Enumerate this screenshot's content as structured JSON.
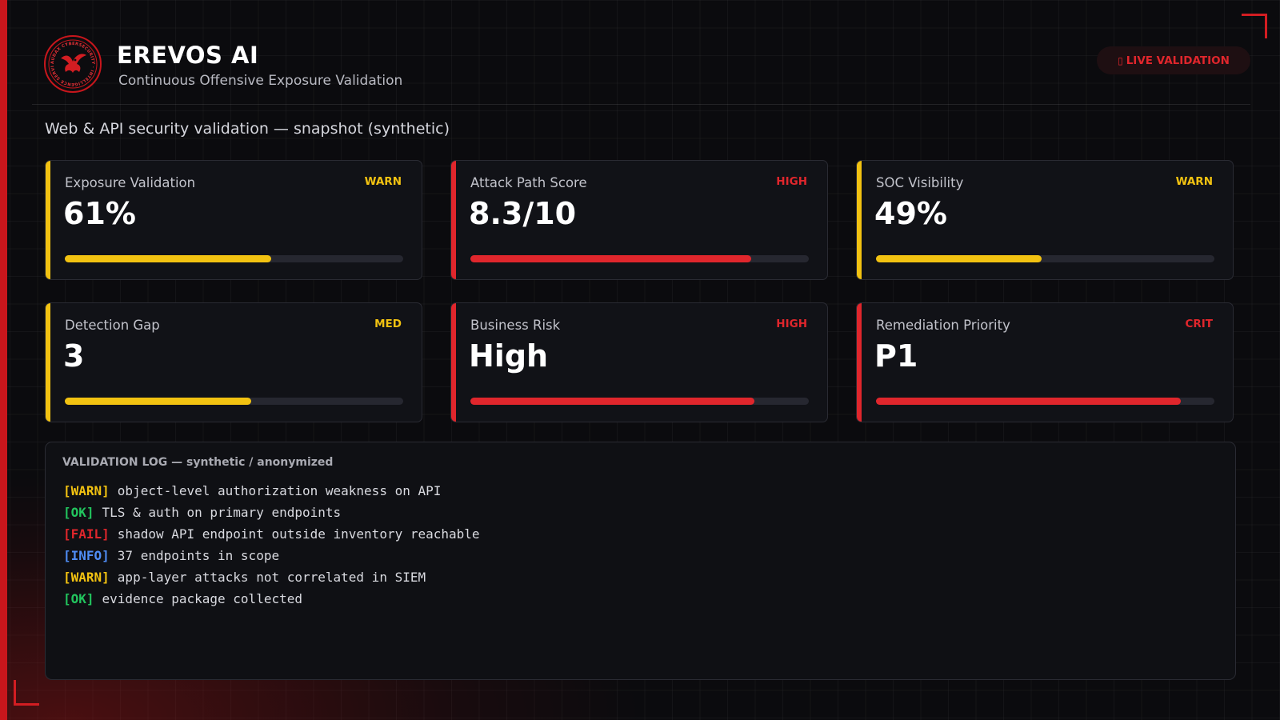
{
  "header": {
    "title": "EREVOS AI",
    "subtitle": "Continuous Offensive Exposure Validation",
    "logo_text": "AUDAX CYBERSECURITY · INTELLIGENCE SERVICES",
    "live_badge": {
      "icon": "dot-icon",
      "glyph": "▯",
      "label": "LIVE VALIDATION"
    }
  },
  "section_title": "Web & API security validation — snapshot (synthetic)",
  "colors": {
    "warn": "#f2c211",
    "high": "#e0262c",
    "ok": "#22c55e",
    "info": "#4f8df5",
    "accent": "#c8161c"
  },
  "cards": [
    {
      "label": "Exposure Validation",
      "value": "61%",
      "status": "WARN",
      "level": 0.61,
      "color": "#f2c211"
    },
    {
      "label": "Attack Path Score",
      "value": "8.3/10",
      "status": "HIGH",
      "level": 0.83,
      "color": "#e0262c"
    },
    {
      "label": "SOC Visibility",
      "value": "49%",
      "status": "WARN",
      "level": 0.49,
      "color": "#f2c211"
    },
    {
      "label": "Detection Gap",
      "value": "3",
      "status": "MED",
      "level": 0.55,
      "color": "#f2c211"
    },
    {
      "label": "Business Risk",
      "value": "High",
      "status": "HIGH",
      "level": 0.84,
      "color": "#e0262c"
    },
    {
      "label": "Remediation Priority",
      "value": "P1",
      "status": "CRIT",
      "level": 0.9,
      "color": "#e0262c"
    }
  ],
  "log": {
    "title": "VALIDATION LOG — synthetic / anonymized",
    "lines": [
      {
        "tag": "[WARN]",
        "color": "#f2c211",
        "text": "object-level authorization weakness on API"
      },
      {
        "tag": "[OK]",
        "color": "#22c55e",
        "text": "TLS & auth on primary endpoints"
      },
      {
        "tag": "[FAIL]",
        "color": "#e0262c",
        "text": "shadow API endpoint outside inventory reachable"
      },
      {
        "tag": "[INFO]",
        "color": "#4f8df5",
        "text": "37 endpoints in scope"
      },
      {
        "tag": "[WARN]",
        "color": "#f2c211",
        "text": "app-layer attacks not correlated in SIEM"
      },
      {
        "tag": "[OK]",
        "color": "#22c55e",
        "text": "evidence package collected"
      }
    ]
  }
}
